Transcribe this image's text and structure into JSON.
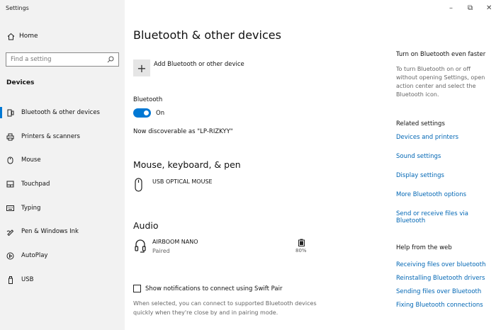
{
  "app": {
    "title": "Settings"
  },
  "sidebar": {
    "home_label": "Home",
    "search_placeholder": "Find a setting",
    "section_title": "Devices",
    "items": [
      {
        "label": "Bluetooth & other devices",
        "icon": "bluetooth-icon",
        "active": true
      },
      {
        "label": "Printers & scanners",
        "icon": "printer-icon"
      },
      {
        "label": "Mouse",
        "icon": "mouse-icon"
      },
      {
        "label": "Touchpad",
        "icon": "touchpad-icon"
      },
      {
        "label": "Typing",
        "icon": "keyboard-icon"
      },
      {
        "label": "Pen & Windows Ink",
        "icon": "pen-icon"
      },
      {
        "label": "AutoPlay",
        "icon": "autoplay-icon"
      },
      {
        "label": "USB",
        "icon": "usb-icon"
      }
    ]
  },
  "window_controls": {
    "minimize": "–",
    "restore": "⧉",
    "close": "✕"
  },
  "main": {
    "title": "Bluetooth & other devices",
    "add_device_label": "Add Bluetooth or other device",
    "add_device_glyph": "+",
    "bluetooth_label": "Bluetooth",
    "bluetooth_state": "On",
    "discoverable_text": "Now discoverable as \"LP-RIZKYY\"",
    "mkp_heading": "Mouse, keyboard, & pen",
    "mouse_device": "USB OPTICAL MOUSE",
    "audio_heading": "Audio",
    "audio_device": "AIRBOOM NANO",
    "audio_status": "Paired",
    "audio_battery": "80%",
    "swift_pair_label": "Show notifications to connect using Swift Pair",
    "swift_pair_desc": "When selected, you can connect to supported Bluetooth devices quickly when they're close by and in pairing mode."
  },
  "right": {
    "tip_heading": "Turn on Bluetooth even faster",
    "tip_text": "To turn Bluetooth on or off without opening Settings, open action center and select the Bluetooth icon.",
    "related_heading": "Related settings",
    "related_links": [
      "Devices and printers",
      "Sound settings",
      "Display settings",
      "More Bluetooth options",
      "Send or receive files via Bluetooth"
    ],
    "web_heading": "Help from the web",
    "web_links": [
      "Receiving files over bluetooth",
      "Reinstalling Bluetooth drivers",
      "Sending files over Bluetooth",
      "Fixing Bluetooth connections"
    ]
  },
  "colors": {
    "accent": "#0078d4",
    "link": "#0066b4",
    "sidebar_bg": "#f2f2f2"
  }
}
